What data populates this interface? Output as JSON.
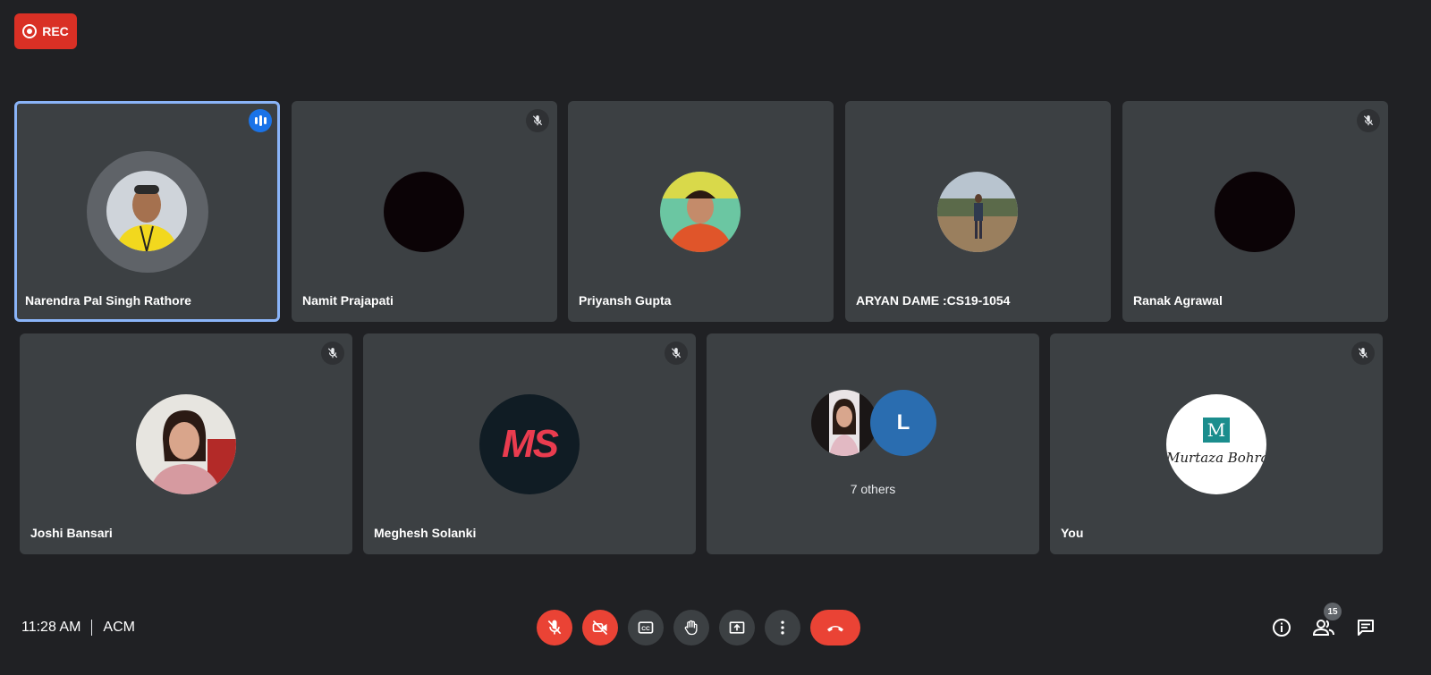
{
  "recording": {
    "label": "REC"
  },
  "participants_row1": [
    {
      "name": "Narendra Pal Singh Rathore",
      "speaking": true
    },
    {
      "name": "Namit Prajapati",
      "muted": true
    },
    {
      "name": "Priyansh Gupta"
    },
    {
      "name": "ARYAN DAME :CS19-1054"
    },
    {
      "name": "Ranak Agrawal",
      "muted": true
    }
  ],
  "participants_row2": [
    {
      "name": "Joshi Bansari",
      "muted": true
    },
    {
      "name": "Meghesh Solanki",
      "muted": true,
      "avatar_text": "MS"
    },
    {
      "others_label": "7 others",
      "avatar_letter": "L"
    },
    {
      "name": "You",
      "muted": true,
      "avatar_text": "M",
      "avatar_script": "Murtaza Bohra"
    }
  ],
  "footer": {
    "time": "11:28 AM",
    "meeting_name": "ACM",
    "participants_count": "15"
  },
  "colors": {
    "background": "#202124",
    "tile": "#3c4043",
    "accent": "#8ab4f8",
    "danger": "#ea4335",
    "rec": "#d93025"
  }
}
